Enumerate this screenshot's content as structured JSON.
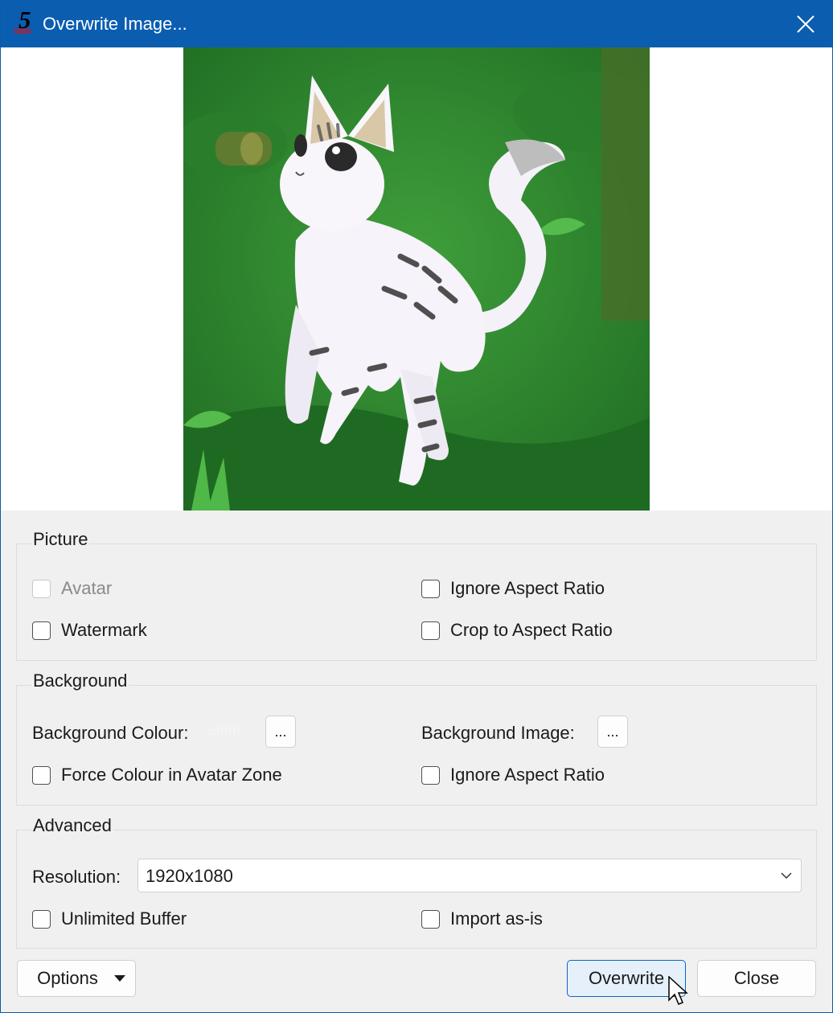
{
  "window": {
    "title": "Overwrite Image...",
    "app_icon_text": "5",
    "app_icon_sub": "VIEW"
  },
  "picture": {
    "title": "Picture",
    "avatar": "Avatar",
    "ignore_aspect_ratio": "Ignore Aspect Ratio",
    "watermark": "Watermark",
    "crop_to_aspect_ratio": "Crop to Aspect Ratio"
  },
  "background": {
    "title": "Background",
    "colour_label": "Background Colour:",
    "colour_value": "#ffffff",
    "colour_button": "...",
    "image_label": "Background Image:",
    "image_button": "...",
    "force_colour": "Force Colour in Avatar Zone",
    "ignore_aspect_ratio": "Ignore Aspect Ratio"
  },
  "advanced": {
    "title": "Advanced",
    "resolution_label": "Resolution:",
    "resolution_value": "1920x1080",
    "unlimited_buffer": "Unlimited Buffer",
    "import_as_is": "Import as-is"
  },
  "footer": {
    "options": "Options",
    "overwrite": "Overwrite",
    "close": "Close"
  },
  "colors": {
    "titlebar": "#0b5db0",
    "primary_border": "#0e65c0",
    "preview_green": "#2f8a2f"
  },
  "icons": [
    "app-logo-icon",
    "close-icon",
    "chevron-down-icon",
    "dropdown-arrow-icon",
    "mouse-cursor-icon"
  ]
}
